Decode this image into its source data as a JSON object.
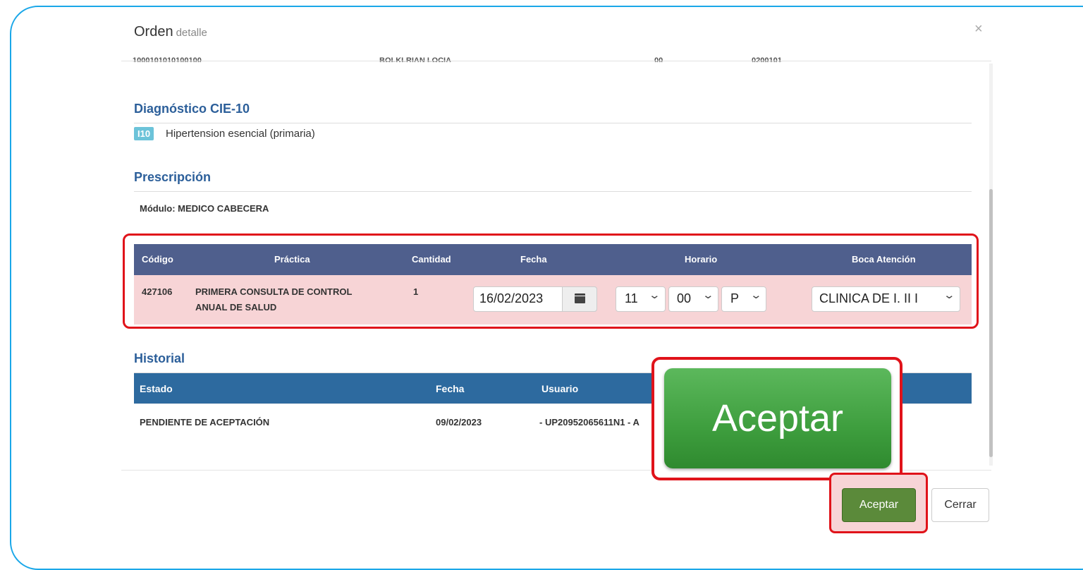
{
  "modal": {
    "title": "Orden",
    "subtitle": "detalle",
    "close_glyph": "×"
  },
  "cut_row": {
    "c1": "1000101010100100",
    "c2": "BOLKLRIAN LOCIA",
    "c3": "00",
    "c4": "0200101"
  },
  "diagnostico": {
    "title": "Diagnóstico CIE-10",
    "code": "I10",
    "description": "Hipertension esencial (primaria)"
  },
  "prescripcion": {
    "title": "Prescripción",
    "modulo": "Módulo: MEDICO CABECERA",
    "headers": {
      "codigo": "Código",
      "practica": "Práctica",
      "cantidad": "Cantidad",
      "fecha": "Fecha",
      "horario": "Horario",
      "boca": "Boca Atención"
    },
    "row": {
      "codigo": "427106",
      "practica_line1": "PRIMERA CONSULTA DE CONTROL",
      "practica_line2": "ANUAL DE SALUD",
      "cantidad": "1",
      "fecha": "16/02/2023",
      "hora": "11",
      "minuto": "00",
      "ampm": "P",
      "boca": "CLINICA DE I. II I"
    }
  },
  "historial": {
    "title": "Historial",
    "headers": {
      "estado": "Estado",
      "fecha": "Fecha",
      "usuario": "Usuario"
    },
    "rows": [
      {
        "estado": "PENDIENTE DE ACEPTACIÓN",
        "fecha": "09/02/2023",
        "usuario": "- UP20952065611N1 - A"
      }
    ]
  },
  "callout": {
    "label": "Aceptar"
  },
  "footer": {
    "accept_label": "Aceptar",
    "close_label": "Cerrar"
  },
  "icons": {
    "calendar": "calendar-icon",
    "chevron": "chevron-down-icon",
    "close": "close-icon"
  },
  "colors": {
    "frame": "#1aa7e8",
    "highlight": "#e0131a",
    "section_title": "#2c5f9a",
    "presc_header": "#4f5f8d",
    "hist_header": "#2d6a9f",
    "accept": "#5b8a3a",
    "callout_green": "#4cae4c"
  }
}
